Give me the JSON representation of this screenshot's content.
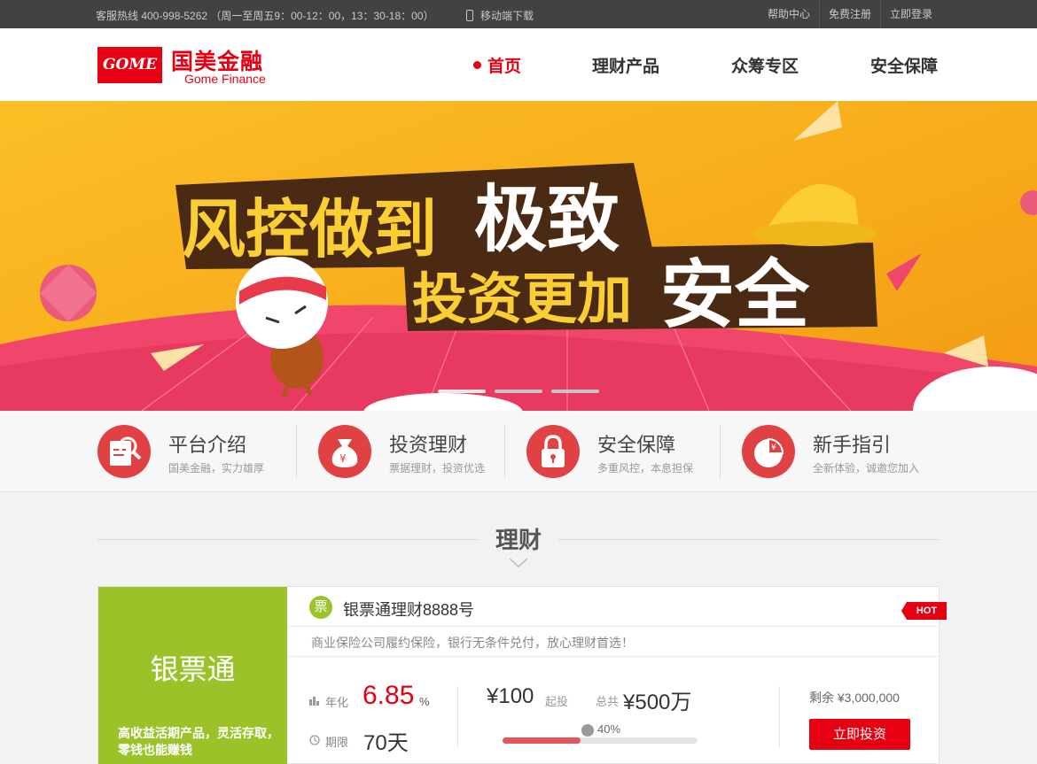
{
  "topbar": {
    "hotline": "客服热线 400-998-5262 （周一至周五9：00-12：00，13：30-18：00）",
    "mobile": "移动端下载",
    "links": [
      "帮助中心",
      "免费注册",
      "立即登录"
    ]
  },
  "header": {
    "logo_box": "GOME",
    "logo_cn": "国美金融",
    "logo_en": "Gome Finance",
    "nav": [
      "首页",
      "理财产品",
      "众筹专区",
      "安全保障"
    ]
  },
  "banner": {
    "line1a": "风控做到",
    "line1b": "极致",
    "line2a": "投资更加",
    "line2b": "安全",
    "slide_count": 3,
    "active_slide": 1
  },
  "features": [
    {
      "title": "平台介绍",
      "sub": "国美金融，实力雄厚",
      "icon": "document-search-icon"
    },
    {
      "title": "投资理财",
      "sub": "票据理财，投资优选",
      "icon": "money-bag-icon"
    },
    {
      "title": "安全保障",
      "sub": "多重风控，本息担保",
      "icon": "lock-icon"
    },
    {
      "title": "新手指引",
      "sub": "全新体验，诚邀您加入",
      "icon": "pie-chart-icon"
    }
  ],
  "section": {
    "title": "理财"
  },
  "product": {
    "name": "银票通",
    "desc": "高收益活期产品，灵活存取，零钱也能赚钱",
    "badge": "票",
    "title": "银票通理财8888号",
    "hot": "HOT",
    "subtitle": "商业保险公司履约保险，银行无条件兑付，放心理财首选！",
    "rate_label": "年化",
    "rate": "6.85",
    "rate_unit": "%",
    "term_label": "期限",
    "term": "70天",
    "min": "¥100",
    "min_label": "起投",
    "total_label": "总共",
    "total": "¥500万",
    "progress_text": "40%",
    "progress": 0.4,
    "remain": "剩余 ¥3,000,000",
    "button": "立即投资"
  },
  "colors": {
    "brand": "#e60012",
    "product": "#9bc229",
    "topbar": "#424242"
  }
}
